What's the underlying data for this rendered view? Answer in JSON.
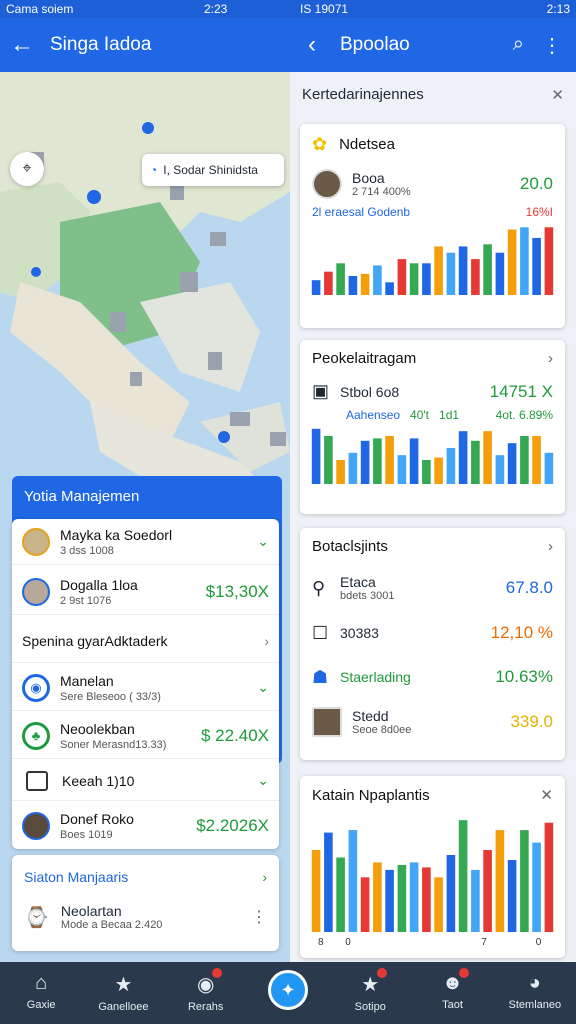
{
  "status_bar": {
    "left_text": "Cama soiem",
    "left_time": "2:23",
    "mid_text": "IS 1907‌1",
    "right_time": "2:13"
  },
  "left_appbar": {
    "title": "Singa Iadoa"
  },
  "right_appbar": {
    "title": "Bpoolao"
  },
  "map": {
    "search_text": "I, Sodar Shinidsta"
  },
  "mgmt": {
    "title": "Yotia Manajemen",
    "rows": [
      {
        "main": "Mayka ka Soedorl",
        "sub": "3 dss 1008",
        "value": ""
      },
      {
        "main": "Dogalla 1loa",
        "sub": "2 9st 1076",
        "value": "$13,30X"
      }
    ],
    "section_label": "Spenina gyarAdktaderk",
    "rows2": [
      {
        "main": "Manelan",
        "sub": "Sere Bleseoo ( 33/3)",
        "value": ""
      },
      {
        "main": "Neoolekban",
        "sub": "Soner Merasnd13.33)",
        "value": "$ 22.40X"
      },
      {
        "main": "Keeah 1)10",
        "sub": "",
        "value": ""
      },
      {
        "main": "Donef Roko",
        "sub": "Boes 1019",
        "value": "$2.2026X"
      }
    ]
  },
  "stat_card": {
    "title": "Siaton Manjaaris",
    "main": "Neolartan",
    "sub": "Mode a Becaa 2.420"
  },
  "right_panel": {
    "header": "Kertedarinajennes",
    "card1": {
      "title": "Ndetsea",
      "line_label": "Booa",
      "line_sub": "2 714 400%",
      "line_value": "20.0",
      "caption_left": "2l eraesal Godenb",
      "caption_right": "16%I"
    },
    "card2": {
      "title": "Peokelaitragam",
      "line_label": "Stbol 6o8",
      "line_value": "14751 X",
      "caption_left": "Aahenseo",
      "caption_mid1": "40't",
      "caption_mid2": "1d1",
      "caption_right": "4ot. 6.89%"
    },
    "card3": {
      "title": "Botaclsjints",
      "items": [
        {
          "label": "Etaca",
          "sub": "bdets 3001",
          "value": "67.8.0",
          "color": "#1f67e4"
        },
        {
          "label": "30383",
          "sub": "",
          "value": "12,10 %",
          "color": "#ef6c00"
        },
        {
          "label": "Staerlading",
          "sub": "",
          "value": "10.63%",
          "color": "#1e9b3b"
        },
        {
          "label": "Stedd",
          "sub": "Seoe 8d0ee",
          "value": "339.0",
          "color": "#e0b400"
        }
      ]
    },
    "card4": {
      "title": "Katain Npaplantis",
      "x_labels": [
        "8",
        "0",
        "",
        "",
        "",
        "",
        "7",
        "",
        "0"
      ]
    }
  },
  "bottom_nav": [
    {
      "label": "Gaxie",
      "icon": "home-icon"
    },
    {
      "label": "Ganelloee",
      "icon": "star-icon"
    },
    {
      "label": "Rerahs",
      "icon": "camera-icon",
      "badge": true
    },
    {
      "label": "",
      "icon": "center-action-icon"
    },
    {
      "label": "Sotipo",
      "icon": "star-icon",
      "badge": true
    },
    {
      "label": "Taot",
      "icon": "person-icon",
      "badge": true
    },
    {
      "label": "Stemlaneo",
      "icon": "profile-icon"
    }
  ],
  "chart_data": [
    {
      "type": "bar",
      "title": "",
      "categories": [
        "1",
        "2",
        "3",
        "4",
        "5",
        "6",
        "7",
        "8",
        "9",
        "10",
        "11",
        "12",
        "13",
        "14",
        "15",
        "16",
        "17",
        "18",
        "19",
        "20"
      ],
      "series": [
        {
          "values": [
            14,
            22,
            30,
            18,
            20,
            28,
            12,
            34,
            30,
            30,
            46,
            40,
            46,
            34,
            48,
            40,
            62,
            64,
            54,
            64
          ]
        }
      ],
      "colors": [
        "#1f67e4",
        "#e53935",
        "#34a853",
        "#1f67e4",
        "#f59e0b",
        "#42a5f5"
      ]
    },
    {
      "type": "bar",
      "title": "",
      "categories": [
        "1",
        "2",
        "3",
        "4",
        "5",
        "6",
        "7",
        "8",
        "9",
        "10",
        "11",
        "12",
        "13",
        "14",
        "15",
        "16",
        "17",
        "18",
        "19",
        "20"
      ],
      "series": [
        {
          "values": [
            46,
            40,
            20,
            26,
            36,
            38,
            40,
            24,
            38,
            20,
            22,
            30,
            44,
            36,
            44,
            24,
            34,
            40,
            40,
            26
          ]
        }
      ],
      "colors": [
        "#1f67e4",
        "#34a853",
        "#f59e0b",
        "#42a5f5"
      ]
    },
    {
      "type": "bar",
      "title": "",
      "categories": [
        "1",
        "2",
        "3",
        "4",
        "5",
        "6",
        "7",
        "8",
        "9",
        "10",
        "11",
        "12",
        "13",
        "14",
        "15",
        "16",
        "17",
        "18",
        "19",
        "20"
      ],
      "series": [
        {
          "values": [
            66,
            80,
            60,
            82,
            44,
            56,
            50,
            54,
            56,
            52,
            44,
            62,
            90,
            50,
            66,
            82,
            58,
            82,
            72,
            88
          ]
        }
      ],
      "colors": [
        "#f59e0b",
        "#1f67e4",
        "#34a853",
        "#42a5f5",
        "#e53935"
      ]
    }
  ]
}
